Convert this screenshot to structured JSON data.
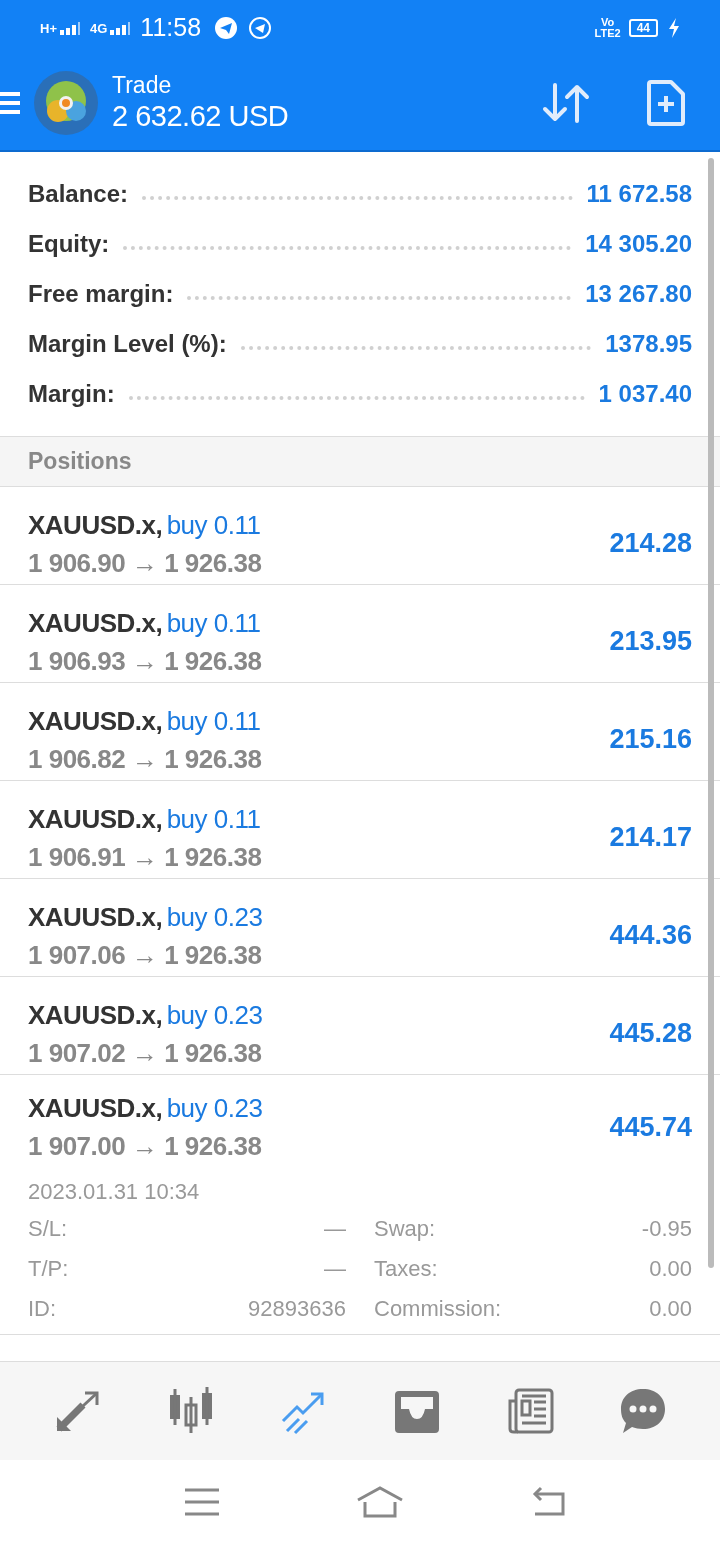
{
  "status_bar": {
    "networks": [
      "H+",
      "4G"
    ],
    "time": "11:58",
    "volte": [
      "Vo",
      "LTE2"
    ],
    "battery": "44"
  },
  "header": {
    "title": "Trade",
    "balance": "2 632.62 USD"
  },
  "summary": [
    {
      "label": "Balance:",
      "value": "11 672.58"
    },
    {
      "label": "Equity:",
      "value": "14 305.20"
    },
    {
      "label": "Free margin:",
      "value": "13 267.80"
    },
    {
      "label": "Margin Level (%):",
      "value": "1378.95"
    },
    {
      "label": "Margin:",
      "value": "1 037.40"
    }
  ],
  "positions_header": "Positions",
  "positions": [
    {
      "symbol": "XAUUSD.x,",
      "side": "buy 0.11",
      "open": "1 906.90",
      "arrow": "→",
      "current": "1 926.38",
      "profit": "214.28",
      "expanded": false
    },
    {
      "symbol": "XAUUSD.x,",
      "side": "buy 0.11",
      "open": "1 906.93",
      "arrow": "→",
      "current": "1 926.38",
      "profit": "213.95",
      "expanded": false
    },
    {
      "symbol": "XAUUSD.x,",
      "side": "buy 0.11",
      "open": "1 906.82",
      "arrow": "→",
      "current": "1 926.38",
      "profit": "215.16",
      "expanded": false
    },
    {
      "symbol": "XAUUSD.x,",
      "side": "buy 0.11",
      "open": "1 906.91",
      "arrow": "→",
      "current": "1 926.38",
      "profit": "214.17",
      "expanded": false
    },
    {
      "symbol": "XAUUSD.x,",
      "side": "buy 0.23",
      "open": "1 907.06",
      "arrow": "→",
      "current": "1 926.38",
      "profit": "444.36",
      "expanded": false
    },
    {
      "symbol": "XAUUSD.x,",
      "side": "buy 0.23",
      "open": "1 907.02",
      "arrow": "→",
      "current": "1 926.38",
      "profit": "445.28",
      "expanded": false
    },
    {
      "symbol": "XAUUSD.x,",
      "side": "buy 0.23",
      "open": "1 907.00",
      "arrow": "→",
      "current": "1 926.38",
      "profit": "445.74",
      "expanded": true,
      "time": "2023.01.31 10:34",
      "details": [
        {
          "label": "S/L:",
          "value": "—"
        },
        {
          "label": "Swap:",
          "value": "-0.95"
        },
        {
          "label": "T/P:",
          "value": "—"
        },
        {
          "label": "Taxes:",
          "value": "0.00"
        },
        {
          "label": "ID:",
          "value": "92893636"
        },
        {
          "label": "Commission:",
          "value": "0.00"
        }
      ]
    }
  ],
  "bottom_nav": [
    {
      "kind": "quotes",
      "selected": false
    },
    {
      "kind": "chart",
      "selected": false
    },
    {
      "kind": "trade",
      "selected": true
    },
    {
      "kind": "history",
      "selected": false
    },
    {
      "kind": "news",
      "selected": false
    },
    {
      "kind": "chat",
      "selected": false
    }
  ],
  "system_nav": [
    {
      "kind": "menu"
    },
    {
      "kind": "home"
    },
    {
      "kind": "back"
    }
  ]
}
